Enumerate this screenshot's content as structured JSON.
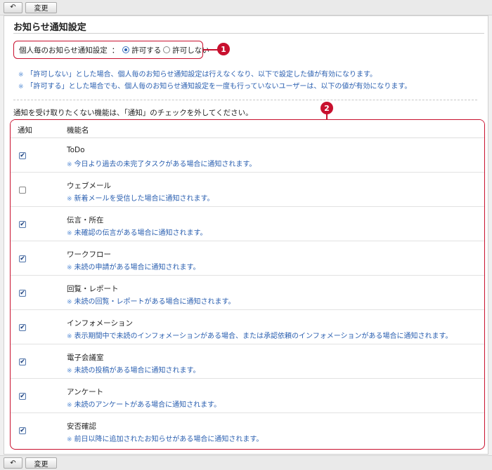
{
  "toolbar": {
    "back_icon": "back-arrow-icon",
    "back_glyph": "↶",
    "change_label": "変更"
  },
  "page": {
    "title": "お知らせ通知設定"
  },
  "personal_setting": {
    "label": "個人毎のお知らせ通知設定",
    "separator": "：",
    "options": [
      {
        "label": "許可する",
        "selected": true
      },
      {
        "label": "許可しない",
        "selected": false
      }
    ]
  },
  "markers": [
    "1",
    "2"
  ],
  "notes": [
    "「許可しない」とした場合、個人毎のお知らせ通知設定は行えなくなり、以下で設定した値が有効になります。",
    "「許可する」とした場合でも、個人毎のお知らせ通知設定を一度も行っていないユーザーは、以下の値が有効になります。"
  ],
  "note_star": "※",
  "instruction": "通知を受け取りたくない機能は、「通知」のチェックを外してください。",
  "table": {
    "headers": {
      "notify": "通知",
      "name": "機能名"
    },
    "rows": [
      {
        "name": "ToDo",
        "desc": "今日より過去の未完了タスクがある場合に通知されます。",
        "checked": true
      },
      {
        "name": "ウェブメール",
        "desc": "新着メールを受信した場合に通知されます。",
        "checked": false
      },
      {
        "name": "伝言・所在",
        "desc": "未確認の伝言がある場合に通知されます。",
        "checked": true
      },
      {
        "name": "ワークフロー",
        "desc": "未読の申請がある場合に通知されます。",
        "checked": true
      },
      {
        "name": "回覧・レポート",
        "desc": "未読の回覧・レポートがある場合に通知されます。",
        "checked": true
      },
      {
        "name": "インフォメーション",
        "desc": "表示期間中で未読のインフォメーションがある場合、または承認依頼のインフォメーションがある場合に通知されます。",
        "checked": true
      },
      {
        "name": "電子会議室",
        "desc": "未読の投稿がある場合に通知されます。",
        "checked": true
      },
      {
        "name": "アンケート",
        "desc": "未読のアンケートがある場合に通知されます。",
        "checked": true
      },
      {
        "name": "安否確認",
        "desc": "前日以降に追加されたお知らせがある場合に通知されます。",
        "checked": true
      }
    ]
  },
  "colors": {
    "accent_red": "#c8102e",
    "link_blue": "#2a5fb0"
  }
}
